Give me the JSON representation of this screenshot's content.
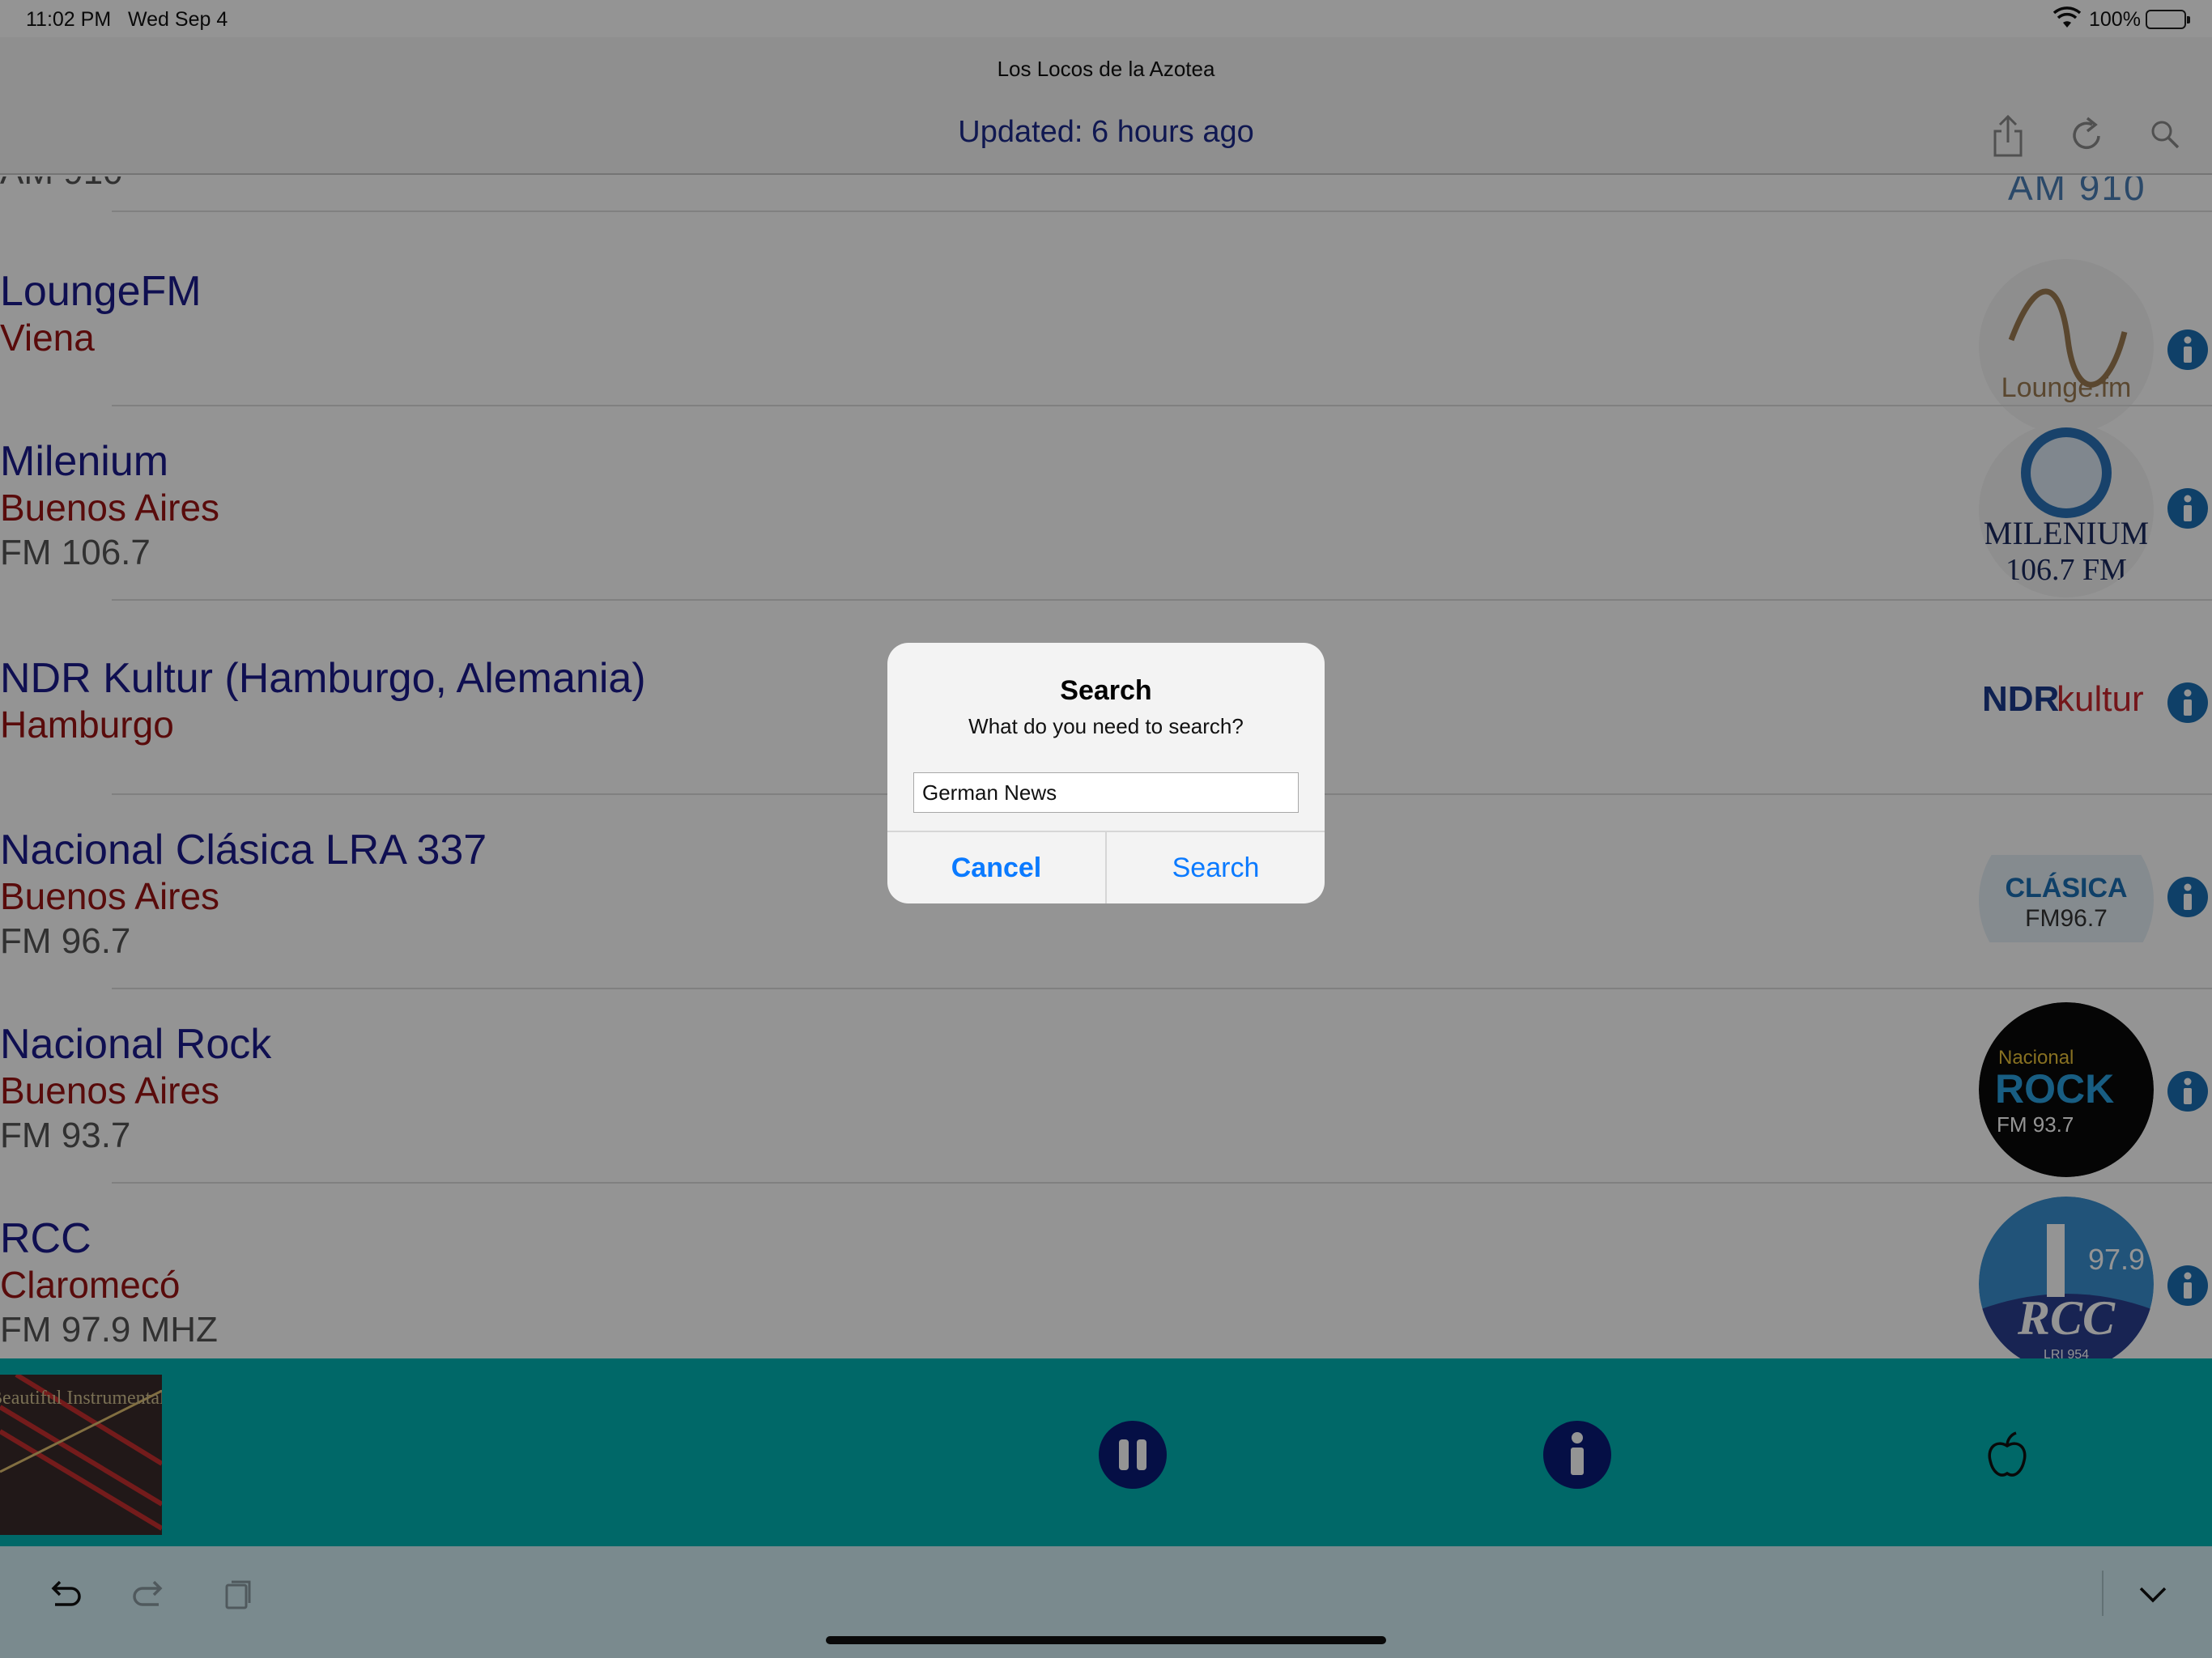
{
  "status_bar": {
    "time": "11:02 PM",
    "date": "Wed Sep 4",
    "battery_percent": "100%"
  },
  "nav": {
    "title": "Los Locos de la Azotea",
    "updated": "Updated: 6 hours ago",
    "icons": [
      "share-icon",
      "refresh-icon",
      "search-icon"
    ]
  },
  "list": {
    "partial_row_text": "AM 910",
    "partial_row_logo": "AM 910",
    "stations": [
      {
        "name": "LoungeFM",
        "city": "Viena",
        "freq": "",
        "logo_text": "Lounge.fm"
      },
      {
        "name": "Milenium",
        "city": "Buenos Aires",
        "freq": "FM 106.7",
        "logo_text": "MILENIUM 106.7 FM"
      },
      {
        "name": "NDR Kultur (Hamburgo, Alemania)",
        "city": "Hamburgo",
        "freq": "",
        "logo_text": "NDR kultur"
      },
      {
        "name": "Nacional Clásica LRA 337",
        "city": "Buenos Aires",
        "freq": "FM 96.7",
        "logo_text": "CLÁSICA FM96.7"
      },
      {
        "name": "Nacional Rock",
        "city": "Buenos Aires",
        "freq": "FM 93.7",
        "logo_text": "Nacional ROCK FM 93.7"
      },
      {
        "name": "RCC",
        "city": "Claromecó",
        "freq": "FM 97.9 MHZ",
        "logo_text": "97.9 RCC LRI 954"
      }
    ]
  },
  "player": {
    "album_text": "Beautiful Instrumentals",
    "icons": [
      "pause-icon",
      "info-icon",
      "apple-icon"
    ]
  },
  "keyboard_bar": {
    "icons": [
      "undo-icon",
      "redo-icon",
      "paste-icon",
      "chevron-down-icon"
    ]
  },
  "alert": {
    "title": "Search",
    "message": "What do you need to search?",
    "input_value": "German News",
    "cancel_label": "Cancel",
    "confirm_label": "Search"
  },
  "colors": {
    "station_name": "#1a1a8c",
    "station_city": "#9a1414",
    "player_bar": "#00b4b4",
    "alert_button": "#0a7aff",
    "keyboard_bar": "#d2eef5"
  }
}
